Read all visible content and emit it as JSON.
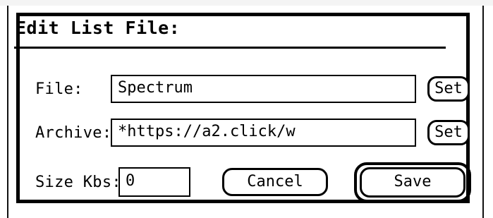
{
  "dialog": {
    "title": "Edit List File:",
    "file": {
      "label": "File:",
      "value": "Spectrum",
      "set_label": "Set"
    },
    "archive": {
      "label": "Archive:",
      "value": "*https://a2.click/w",
      "set_label": "Set"
    },
    "size": {
      "label": "Size Kbs:",
      "value": "0"
    },
    "cancel_label": "Cancel",
    "save_label": "Save"
  }
}
